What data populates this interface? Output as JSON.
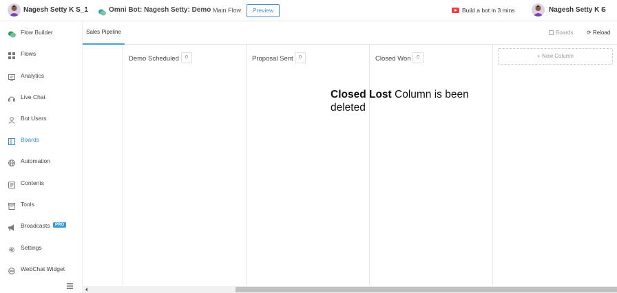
{
  "topbar": {
    "workspace_name": "Nagesh Setty K S_1",
    "bot_name": "Omni Bot: Nagesh Setty: Demo",
    "flow_name": "Main Flow",
    "preview_label": "Preview",
    "build_label": "Build a bot in 3 mins",
    "user_name": "Nagesh Setty K S"
  },
  "sidebar": {
    "items": [
      {
        "label": "Flow Builder",
        "icon": "flow-builder-icon"
      },
      {
        "label": "Flows",
        "icon": "grid-icon"
      },
      {
        "label": "Analytics",
        "icon": "analytics-icon"
      },
      {
        "label": "Live Chat",
        "icon": "live-chat-icon"
      },
      {
        "label": "Bot Users",
        "icon": "user-icon"
      },
      {
        "label": "Boards",
        "icon": "boards-icon"
      },
      {
        "label": "Automation",
        "icon": "globe-icon"
      },
      {
        "label": "Contents",
        "icon": "contents-icon"
      },
      {
        "label": "Tools",
        "icon": "tools-icon"
      },
      {
        "label": "Broadcasts",
        "icon": "megaphone-icon",
        "badge": "PRO"
      },
      {
        "label": "Settings",
        "icon": "gear-icon"
      },
      {
        "label": "WebChat Widget",
        "icon": "chat-bubble-icon"
      }
    ],
    "active": "Boards"
  },
  "tabs": {
    "active_label": "Sales Pipeline"
  },
  "toolbar": {
    "boards_label": "Boards",
    "reload_label": "Reload"
  },
  "board": {
    "columns": [
      {
        "title": "Demo Scheduled",
        "count": "0"
      },
      {
        "title": "Proposal Sent",
        "count": "0"
      },
      {
        "title": "Closed Won",
        "count": "0"
      }
    ],
    "new_column_label": "+ New Column"
  },
  "note": {
    "bold": "Closed Lost",
    "rest": " Column is been deleted"
  },
  "colors": {
    "accent": "#2f8ad0",
    "youtube_red": "#e7413f"
  }
}
